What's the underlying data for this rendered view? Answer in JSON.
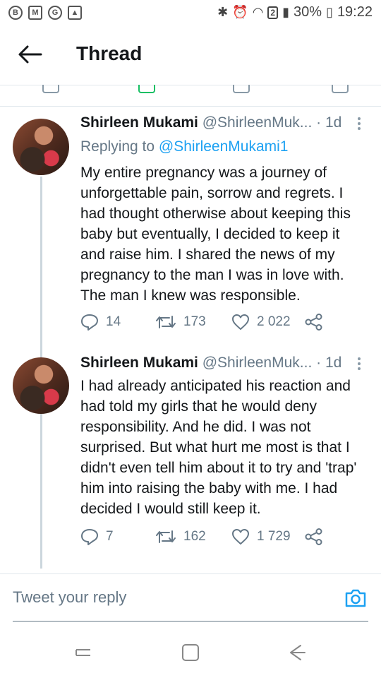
{
  "status_bar": {
    "left_icons": [
      "b-icon",
      "gmail-icon",
      "google-icon",
      "image-icon"
    ],
    "sim_badge": "2",
    "battery": "30%",
    "time": "19:22"
  },
  "header": {
    "title": "Thread"
  },
  "tweets": [
    {
      "name": "Shirleen Mukami",
      "handle": "@ShirleenMuk...",
      "dot": "·",
      "time": "1d",
      "replying_prefix": "Replying to",
      "replying_handle": "@ShirleenMukami1",
      "text": "My entire pregnancy was a journey of unforgettable pain, sorrow and regrets. I had thought otherwise about keeping this baby but eventually, I decided to keep it and raise him. I shared the news of my pregnancy to the man I was in love with. The man I knew was responsible.",
      "replies": "14",
      "retweets": "173",
      "likes": "2 022"
    },
    {
      "name": "Shirleen Mukami",
      "handle": "@ShirleenMuk...",
      "dot": "·",
      "time": "1d",
      "text": "I had already anticipated his reaction and had told my girls that he would deny responsibility. And he did. I was not surprised. But what hurt me most is that I didn't even tell him about it to try and 'trap' him into raising the baby with me. I had decided I would still keep it.",
      "replies": "7",
      "retweets": "162",
      "likes": "1 729"
    }
  ],
  "reply": {
    "placeholder": "Tweet your reply"
  },
  "colors": {
    "accent": "#1da1f2",
    "muted": "#657786",
    "text": "#14171a",
    "divider": "#e1e8ed"
  }
}
